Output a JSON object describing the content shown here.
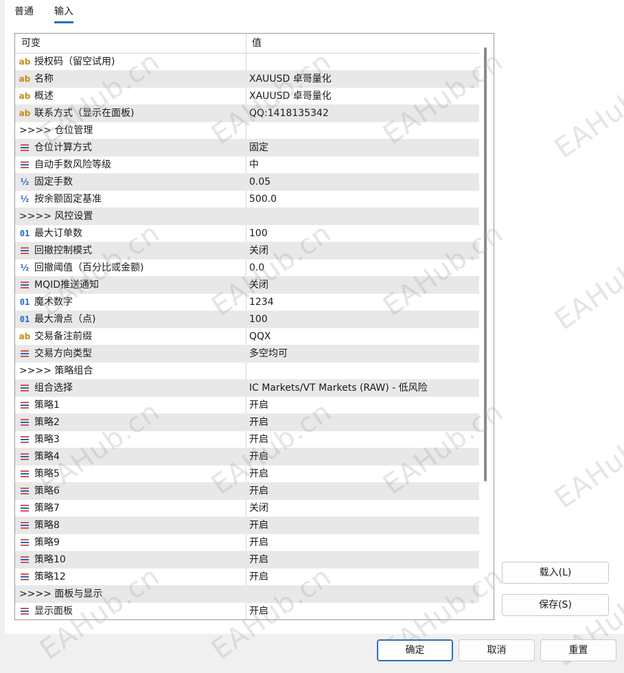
{
  "tabs": [
    {
      "label": "普通",
      "active": false
    },
    {
      "label": "输入",
      "active": true
    }
  ],
  "grid": {
    "header": {
      "col1": "可变",
      "col2": "值"
    },
    "rows": [
      {
        "icon": "ab",
        "name": "授权码（留空试用)",
        "value": ""
      },
      {
        "icon": "ab",
        "name": "名称",
        "value": "XAUUSD 卓哥量化"
      },
      {
        "icon": "ab",
        "name": "概述",
        "value": "XAUUSD 卓哥量化"
      },
      {
        "icon": "ab",
        "name": "联系方式（显示在面板)",
        "value": "QQ:1418135342"
      },
      {
        "icon": "",
        "name": ">>>> 仓位管理",
        "value": ""
      },
      {
        "icon": "enum",
        "name": "仓位计算方式",
        "value": "固定"
      },
      {
        "icon": "enum",
        "name": "自动手数风险等级",
        "value": "中"
      },
      {
        "icon": "half",
        "name": "固定手数",
        "value": "0.05"
      },
      {
        "icon": "half",
        "name": "按余额固定基准",
        "value": "500.0"
      },
      {
        "icon": "",
        "name": ">>>> 风控设置",
        "value": ""
      },
      {
        "icon": "01",
        "name": "最大订单数",
        "value": "100"
      },
      {
        "icon": "enum",
        "name": "回撤控制模式",
        "value": "关闭"
      },
      {
        "icon": "half",
        "name": "回撤阈值（百分比或金额)",
        "value": "0.0"
      },
      {
        "icon": "enum",
        "name": "MQID推送通知",
        "value": "关闭"
      },
      {
        "icon": "01",
        "name": "魔术数字",
        "value": "1234"
      },
      {
        "icon": "01",
        "name": "最大滑点（点)",
        "value": "100"
      },
      {
        "icon": "ab",
        "name": "交易备注前缀",
        "value": "QQX"
      },
      {
        "icon": "enum",
        "name": "交易方向类型",
        "value": "多空均可"
      },
      {
        "icon": "",
        "name": ">>>> 策略组合",
        "value": ""
      },
      {
        "icon": "enum",
        "name": "组合选择",
        "value": "IC Markets/VT Markets (RAW) - 低风险"
      },
      {
        "icon": "enum",
        "name": "策略1",
        "value": "开启"
      },
      {
        "icon": "enum",
        "name": "策略2",
        "value": "开启"
      },
      {
        "icon": "enum",
        "name": "策略3",
        "value": "开启"
      },
      {
        "icon": "enum",
        "name": "策略4",
        "value": "开启"
      },
      {
        "icon": "enum",
        "name": "策略5",
        "value": "开启"
      },
      {
        "icon": "enum",
        "name": "策略6",
        "value": "开启"
      },
      {
        "icon": "enum",
        "name": "策略7",
        "value": "关闭"
      },
      {
        "icon": "enum",
        "name": "策略8",
        "value": "开启"
      },
      {
        "icon": "enum",
        "name": "策略9",
        "value": "开启"
      },
      {
        "icon": "enum",
        "name": "策略10",
        "value": "开启"
      },
      {
        "icon": "enum",
        "name": "策略12",
        "value": "开启"
      },
      {
        "icon": "",
        "name": ">>>> 面板与显示",
        "value": ""
      },
      {
        "icon": "enum",
        "name": "显示面板",
        "value": "开启"
      }
    ]
  },
  "buttons": {
    "load": "载入(L)",
    "save": "保存(S)",
    "ok": "确定",
    "cancel": "取消",
    "reset": "重置"
  },
  "watermark": "EAHub.cn",
  "colors": {
    "accent": "#2a6fbd",
    "icon_string": "#c98a1a",
    "icon_number": "#2266c4",
    "row_alt": "#e8e8e8"
  }
}
